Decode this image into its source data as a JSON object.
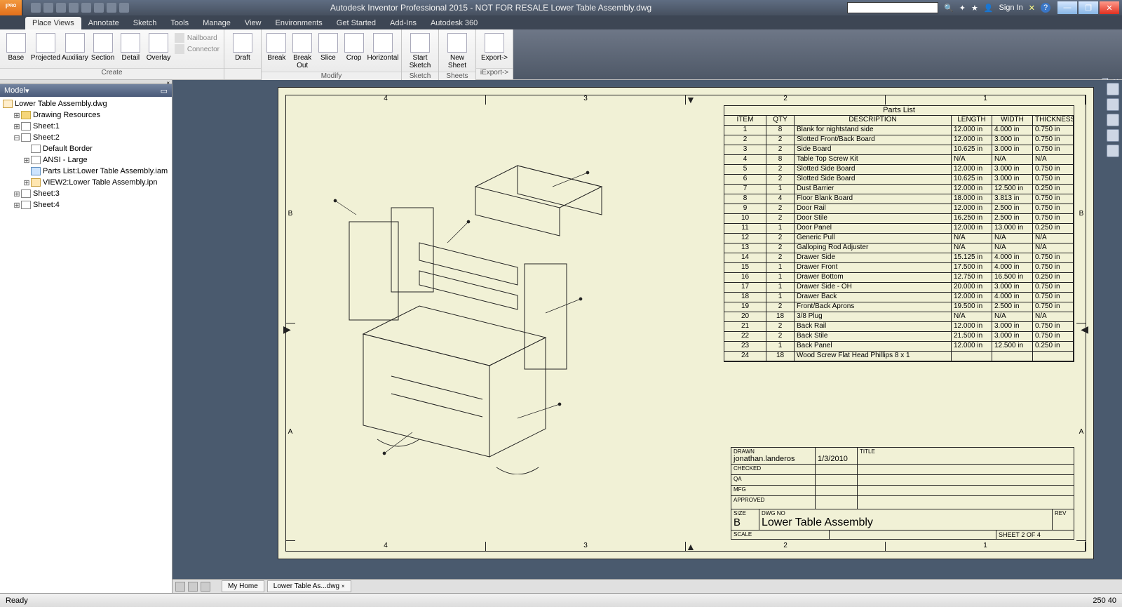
{
  "app": {
    "title": "Autodesk Inventor Professional 2015 - NOT FOR RESALE    Lower Table Assembly.dwg",
    "signin": "Sign In"
  },
  "tabs": [
    "Place Views",
    "Annotate",
    "Sketch",
    "Tools",
    "Manage",
    "View",
    "Environments",
    "Get Started",
    "Add-Ins",
    "Autodesk 360"
  ],
  "active_tab": "Place Views",
  "ribbon": {
    "create": {
      "label": "Create",
      "buttons": [
        "Base",
        "Projected",
        "Auxiliary",
        "Section",
        "Detail",
        "Overlay"
      ],
      "side": [
        "Nailboard",
        "Connector"
      ]
    },
    "draft": {
      "label": "",
      "buttons": [
        "Draft"
      ]
    },
    "modify": {
      "label": "Modify",
      "buttons": [
        "Break",
        "Break Out",
        "Slice",
        "Crop",
        "Horizontal"
      ]
    },
    "sketch": {
      "label": "Sketch",
      "buttons": [
        "Start Sketch"
      ]
    },
    "sheets": {
      "label": "Sheets",
      "buttons": [
        "New Sheet"
      ]
    },
    "iexport": {
      "label": "iExport->",
      "buttons": [
        "Export->"
      ]
    }
  },
  "browser": {
    "title": "Model",
    "root": "Lower Table Assembly.dwg",
    "items": [
      {
        "indent": 1,
        "icon": "folder",
        "label": "Drawing Resources",
        "tw": "+"
      },
      {
        "indent": 1,
        "icon": "sheet",
        "label": "Sheet:1",
        "tw": "+"
      },
      {
        "indent": 1,
        "icon": "sheet",
        "label": "Sheet:2",
        "tw": "-"
      },
      {
        "indent": 2,
        "icon": "sheet",
        "label": "Default Border",
        "tw": ""
      },
      {
        "indent": 2,
        "icon": "sheet",
        "label": "ANSI - Large",
        "tw": "+"
      },
      {
        "indent": 2,
        "icon": "part",
        "label": "Parts List:Lower Table Assembly.iam",
        "tw": ""
      },
      {
        "indent": 2,
        "icon": "view",
        "label": "VIEW2:Lower Table Assembly.ipn",
        "tw": "+"
      },
      {
        "indent": 1,
        "icon": "sheet",
        "label": "Sheet:3",
        "tw": "+"
      },
      {
        "indent": 1,
        "icon": "sheet",
        "label": "Sheet:4",
        "tw": "+"
      }
    ]
  },
  "sheet": {
    "cols": [
      "4",
      "3",
      "2",
      "1"
    ],
    "rows": [
      "B",
      "A"
    ]
  },
  "parts": {
    "title": "Parts List",
    "headers": [
      "ITEM",
      "QTY",
      "DESCRIPTION",
      "LENGTH",
      "WIDTH",
      "THICKNESS"
    ],
    "rows": [
      [
        "1",
        "8",
        "Blank for nightstand side",
        "12.000 in",
        "4.000 in",
        "0.750 in"
      ],
      [
        "2",
        "2",
        "Slotted Front/Back Board",
        "12.000 in",
        "3.000 in",
        "0.750 in"
      ],
      [
        "3",
        "2",
        "Side Board",
        "10.625 in",
        "3.000 in",
        "0.750 in"
      ],
      [
        "4",
        "8",
        "Table Top Screw Kit",
        "N/A",
        "N/A",
        "N/A"
      ],
      [
        "5",
        "2",
        "Slotted Side Board",
        "12.000 in",
        "3.000 in",
        "0.750 in"
      ],
      [
        "6",
        "2",
        "Slotted Side Board",
        "10.625 in",
        "3.000 in",
        "0.750 in"
      ],
      [
        "7",
        "1",
        "Dust Barrier",
        "12.000 in",
        "12.500 in",
        "0.250 in"
      ],
      [
        "8",
        "4",
        "Floor Blank Board",
        "18.000 in",
        "3.813 in",
        "0.750 in"
      ],
      [
        "9",
        "2",
        "Door Rail",
        "12.000 in",
        "2.500 in",
        "0.750 in"
      ],
      [
        "10",
        "2",
        "Door Stile",
        "16.250 in",
        "2.500 in",
        "0.750 in"
      ],
      [
        "11",
        "1",
        "Door Panel",
        "12.000 in",
        "13.000 in",
        "0.250 in"
      ],
      [
        "12",
        "2",
        "Generic Pull",
        "N/A",
        "N/A",
        "N/A"
      ],
      [
        "13",
        "2",
        "Galloping Rod Adjuster",
        "N/A",
        "N/A",
        "N/A"
      ],
      [
        "14",
        "2",
        "Drawer Side",
        "15.125 in",
        "4.000 in",
        "0.750 in"
      ],
      [
        "15",
        "1",
        "Drawer Front",
        "17.500 in",
        "4.000 in",
        "0.750 in"
      ],
      [
        "16",
        "1",
        "Drawer Bottom",
        "12.750 in",
        "16.500 in",
        "0.250 in"
      ],
      [
        "17",
        "1",
        "Drawer Side - OH",
        "20.000 in",
        "3.000 in",
        "0.750 in"
      ],
      [
        "18",
        "1",
        "Drawer Back",
        "12.000 in",
        "4.000 in",
        "0.750 in"
      ],
      [
        "19",
        "2",
        "Front/Back Aprons",
        "19.500 in",
        "2.500 in",
        "0.750 in"
      ],
      [
        "20",
        "18",
        "3/8 Plug",
        "N/A",
        "N/A",
        "N/A"
      ],
      [
        "21",
        "2",
        "Back Rail",
        "12.000 in",
        "3.000 in",
        "0.750 in"
      ],
      [
        "22",
        "2",
        "Back Stile",
        "21.500 in",
        "3.000 in",
        "0.750 in"
      ],
      [
        "23",
        "1",
        "Back Panel",
        "12.000 in",
        "12.500 in",
        "0.250 in"
      ],
      [
        "24",
        "18",
        "Wood Screw Flat Head Phillips 8 x 1",
        "",
        "",
        ""
      ]
    ]
  },
  "titleblock": {
    "drawn_label": "DRAWN",
    "drawn_by": "jonathan.landeros",
    "drawn_date": "1/3/2010",
    "checked": "CHECKED",
    "qa": "QA",
    "mfg": "MFG",
    "approved": "APPROVED",
    "title_label": "TITLE",
    "size_label": "SIZE",
    "size": "B",
    "dwgno_label": "DWG NO",
    "dwg_title": "Lower Table Assembly",
    "rev_label": "REV",
    "scale_label": "SCALE",
    "sheet_label": "SHEET 2  OF 4"
  },
  "dock": {
    "tabs": [
      "My Home",
      "Lower Table As...dwg"
    ]
  },
  "status": {
    "left": "Ready",
    "coords": "250    40"
  }
}
